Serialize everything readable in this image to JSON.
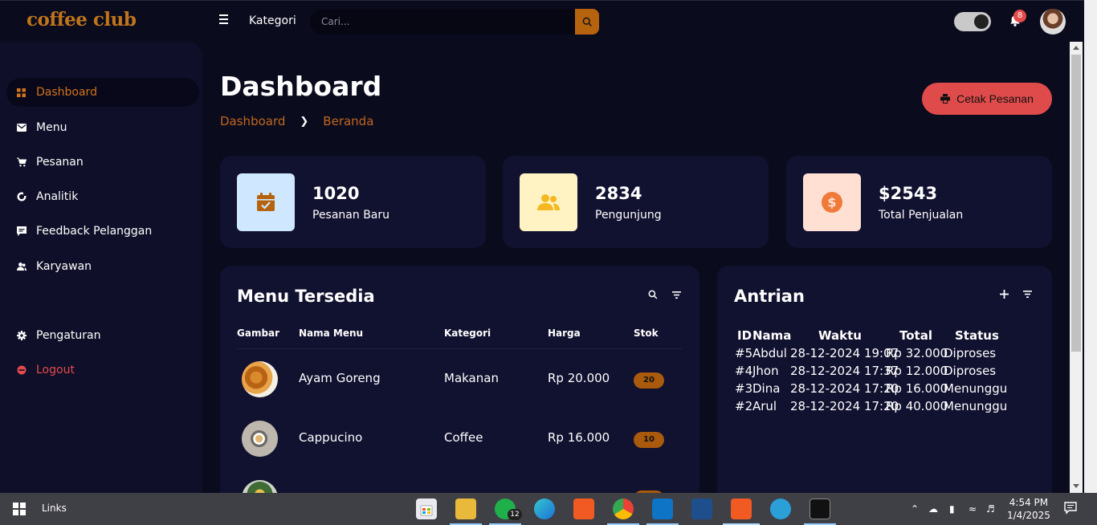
{
  "brand": {
    "logo": "coffee club"
  },
  "topbar": {
    "kategori": "Kategori",
    "search_placeholder": "Cari...",
    "notification_count": "8"
  },
  "sidebar": {
    "items": [
      {
        "label": "Dashboard",
        "icon": "grid-icon",
        "active": true
      },
      {
        "label": "Menu",
        "icon": "envelope-icon"
      },
      {
        "label": "Pesanan",
        "icon": "cart-icon"
      },
      {
        "label": "Analitik",
        "icon": "pie-chart-icon"
      },
      {
        "label": "Feedback Pelanggan",
        "icon": "chat-icon"
      },
      {
        "label": "Karyawan",
        "icon": "users-icon"
      }
    ],
    "settings": "Pengaturan",
    "logout": "Logout"
  },
  "header": {
    "title": "Dashboard",
    "breadcrumb": [
      "Dashboard",
      "Beranda"
    ],
    "print_button": "Cetak Pesanan"
  },
  "stats": [
    {
      "value": "1020",
      "label": "Pesanan Baru",
      "icon": "calendar-check-icon",
      "bg": "#cfe8ff",
      "fg": "#b5630f"
    },
    {
      "value": "2834",
      "label": "Pengunjung",
      "icon": "people-icon",
      "bg": "#fff3c4",
      "fg": "#f5b820"
    },
    {
      "value": "$2543",
      "label": "Total Penjualan",
      "icon": "dollar-icon",
      "bg": "#ffe0d3",
      "fg": "#f07a3a"
    }
  ],
  "menu_panel": {
    "title": "Menu Tersedia",
    "columns": [
      "Gambar",
      "Nama Menu",
      "Kategori",
      "Harga",
      "Stok"
    ],
    "rows": [
      {
        "name": "Ayam Goreng",
        "category": "Makanan",
        "price": "Rp 20.000",
        "stock": "20"
      },
      {
        "name": "Cappucino",
        "category": "Coffee",
        "price": "Rp 16.000",
        "stock": "10"
      }
    ]
  },
  "queue_panel": {
    "title": "Antrian",
    "columns": [
      "ID",
      "Nama",
      "Waktu",
      "Total",
      "Status"
    ],
    "rows": [
      {
        "id": "#5",
        "name": "Abdul",
        "time": "28-12-2024 19:07",
        "total": "Rp 32.000",
        "status": "Diproses"
      },
      {
        "id": "#4",
        "name": "Jhon",
        "time": "28-12-2024 17:37",
        "total": "Rp 12.000",
        "status": "Diproses"
      },
      {
        "id": "#3",
        "name": "Dina",
        "time": "28-12-2024 17:20",
        "total": "Rp 16.000",
        "status": "Menunggu"
      },
      {
        "id": "#2",
        "name": "Arul",
        "time": "28-12-2024 17:20",
        "total": "Rp 40.000",
        "status": "Menunggu"
      }
    ]
  },
  "taskbar": {
    "links": "Links",
    "whatsapp_count": "12",
    "time": "4:54 PM",
    "date": "1/4/2025"
  },
  "colors": {
    "accent": "#c0671d",
    "danger": "#df4b4b",
    "background": "#0b0b1e",
    "card": "#111130"
  }
}
